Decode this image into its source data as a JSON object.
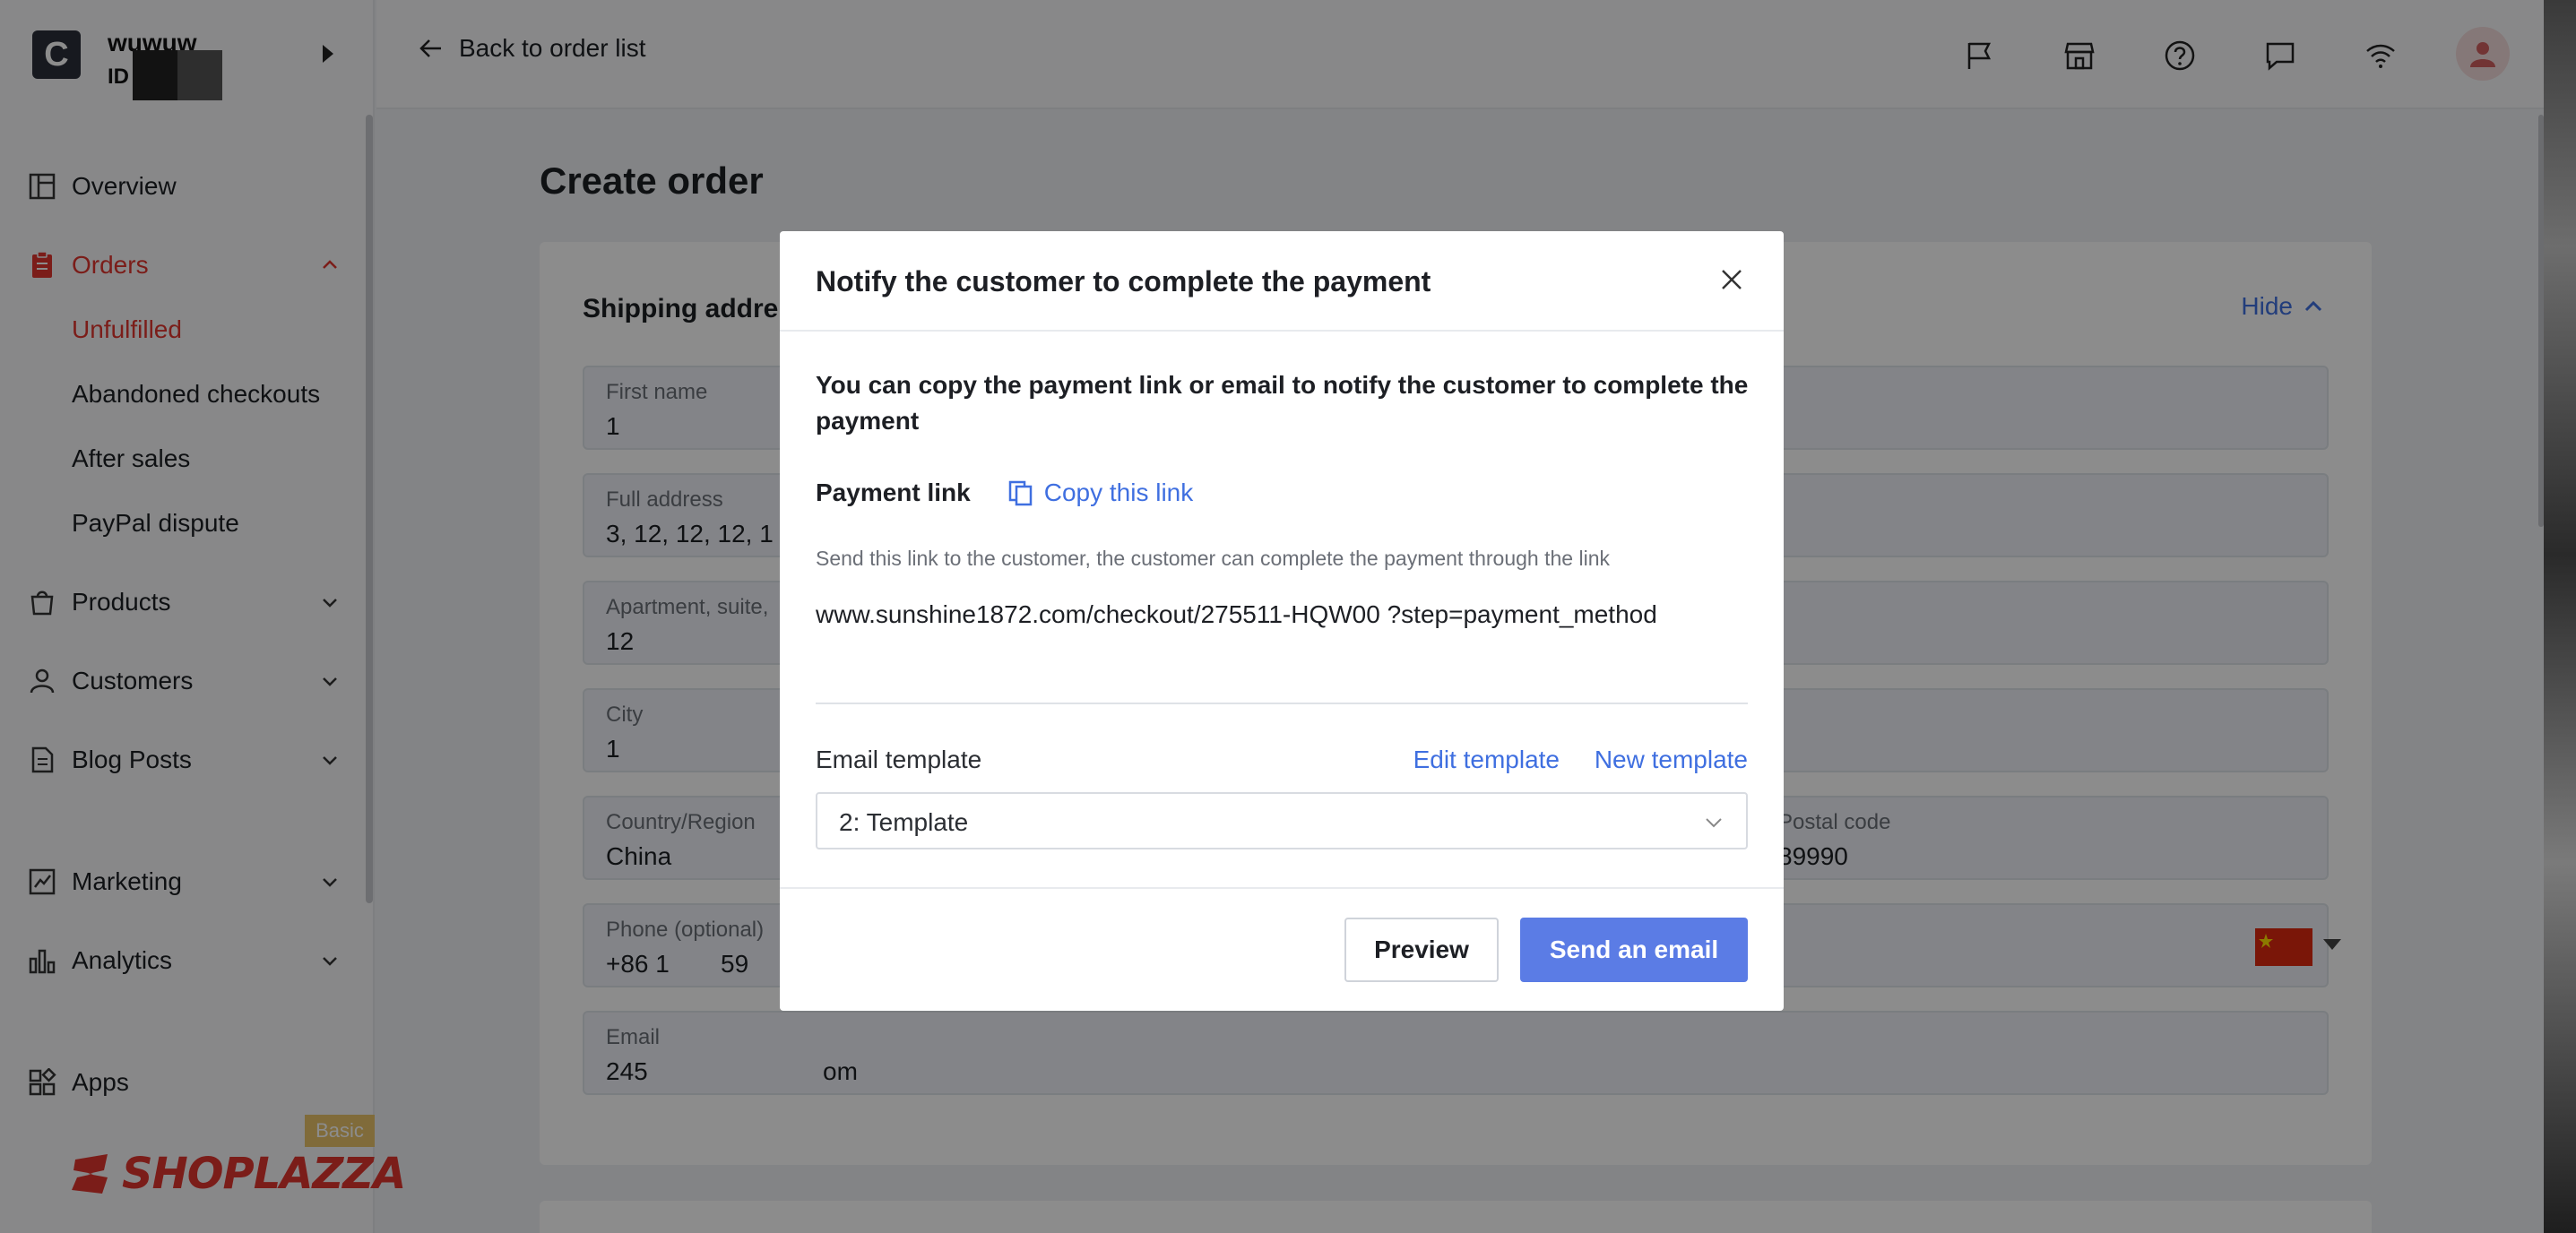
{
  "store": {
    "brand_letter": "C",
    "name": "wuwuw",
    "id_label": "ID"
  },
  "sidebar": {
    "overview": "Overview",
    "orders": "Orders",
    "orders_sub": [
      "Unfulfilled",
      "Abandoned checkouts",
      "After sales",
      "PayPal dispute"
    ],
    "products": "Products",
    "customers": "Customers",
    "blog_posts": "Blog Posts",
    "marketing": "Marketing",
    "analytics": "Analytics",
    "apps": "Apps",
    "plan_badge": "Basic",
    "logo_text": "SHOPLAZZA"
  },
  "topbar": {
    "back_label": "Back to order list",
    "icons": [
      "flag-icon",
      "store-icon",
      "help-icon",
      "chat-icon",
      "wifi-icon",
      "user-avatar-icon"
    ]
  },
  "page": {
    "title": "Create order",
    "section_title": "Shipping addre",
    "hide_label": "Hide",
    "fields": {
      "first_name": {
        "label": "First name",
        "value": "1"
      },
      "full_address": {
        "label": "Full address",
        "value": "3, 12, 12, 12, 1"
      },
      "apartment": {
        "label": "Apartment, suite,",
        "value": "12"
      },
      "city": {
        "label": "City",
        "value": "1"
      },
      "country": {
        "label": "Country/Region",
        "value": "China"
      },
      "postal": {
        "label": "Postal code",
        "value": "89990"
      },
      "phone": {
        "label": "Phone (optional)",
        "value": "+86 1",
        "value_tail": "59"
      },
      "email": {
        "label": "Email",
        "value": "245",
        "value_tail": "om"
      }
    }
  },
  "modal": {
    "title": "Notify the customer to complete the payment",
    "description": "You can copy the payment link or email to notify the customer to complete the payment",
    "payment_link_label": "Payment link",
    "copy_link_label": "Copy this link",
    "hint": "Send this link to the customer, the customer can complete the payment through the link",
    "url": "www.sunshine1872.com/checkout/275511-HQW00          ?step=payment_method",
    "email_template_label": "Email template",
    "edit_template": "Edit template",
    "new_template": "New template",
    "selected_template": "2: Template",
    "preview_button": "Preview",
    "send_button": "Send an email"
  },
  "colors": {
    "accent": "#3f6fe0",
    "brand_red": "#e0352f",
    "primary_button": "#5b7ce5",
    "badge": "#e9c46a"
  }
}
